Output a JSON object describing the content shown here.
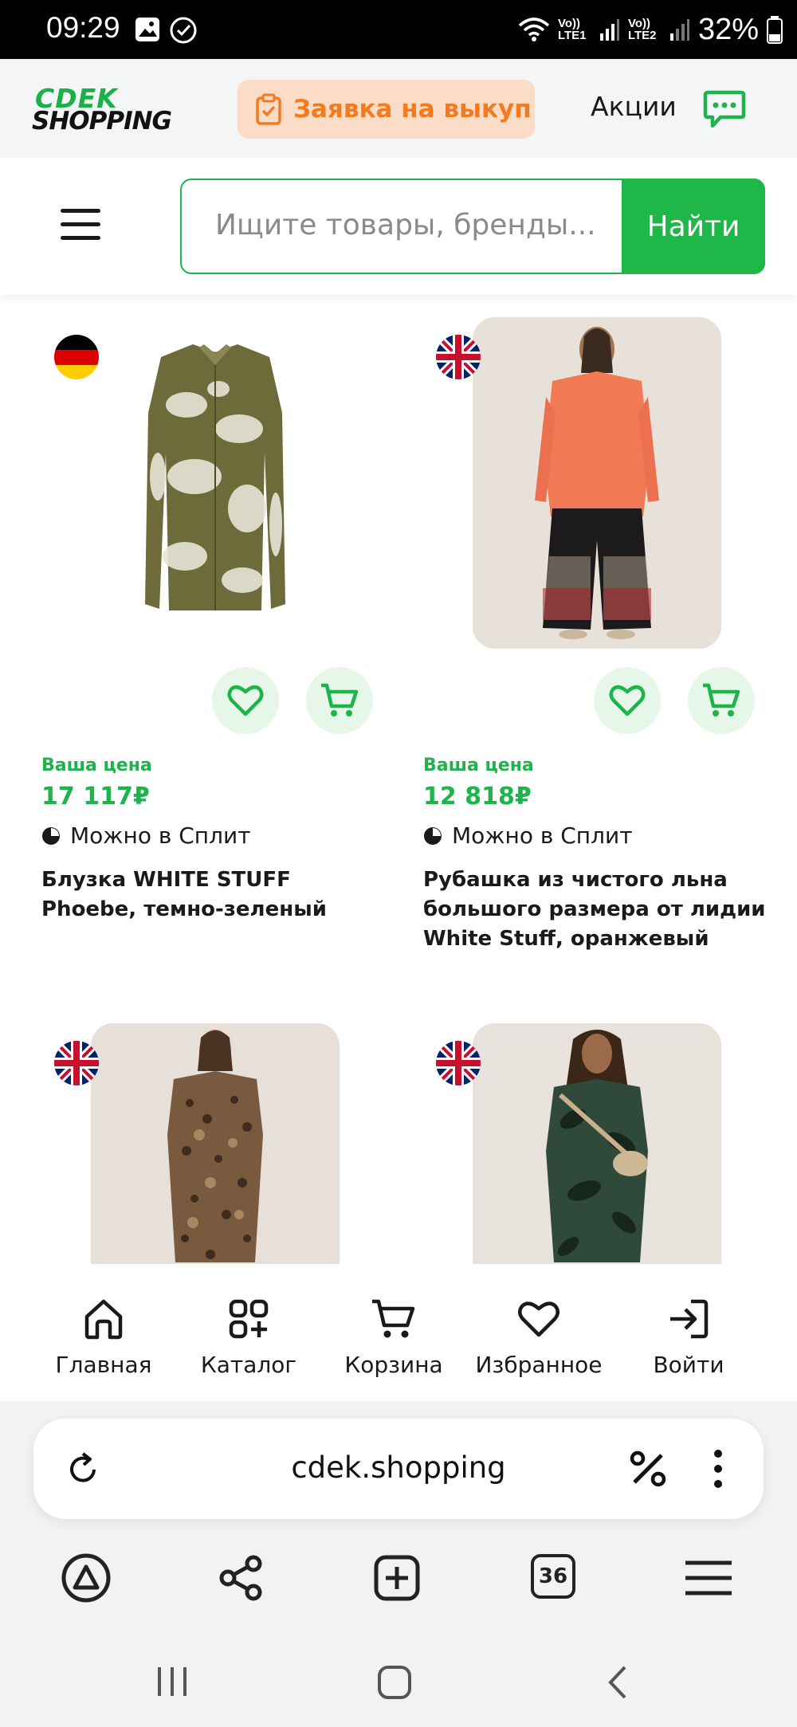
{
  "status_bar": {
    "time": "09:29",
    "sim1": "Vo)) LTE1",
    "sim2": "Vo)) LTE2",
    "battery": "32%"
  },
  "header": {
    "logo_top": "CDEK",
    "logo_bottom": "SHOPPING",
    "buyout_label": "Заявка на выкуп",
    "promo_label": "Акции",
    "accent": "#1db44c",
    "buyout_accent": "#f47a1f"
  },
  "search": {
    "placeholder": "Ищите товары, бренды...",
    "button_label": "Найти"
  },
  "products": [
    {
      "flag": "germany",
      "price_caption": "Ваша цена",
      "price": "17 117₽",
      "split": "Можно в Сплит",
      "title": "Блузка WHITE STUFF Phoebe, темно-зеленый"
    },
    {
      "flag": "uk",
      "price_caption": "Ваша цена",
      "price": "12 818₽",
      "split": "Можно в Сплит",
      "title": "Рубашка из чистого льна большого размера от лидии White Stuff, оранжевый"
    },
    {
      "flag": "uk"
    },
    {
      "flag": "uk"
    }
  ],
  "bottom_nav": [
    {
      "label": "Главная",
      "icon": "home-icon"
    },
    {
      "label": "Каталог",
      "icon": "catalog-icon"
    },
    {
      "label": "Корзина",
      "icon": "cart-icon"
    },
    {
      "label": "Избранное",
      "icon": "heart-icon"
    },
    {
      "label": "Войти",
      "icon": "login-icon"
    }
  ],
  "browser": {
    "url": "cdek.shopping",
    "tabs_count": "36"
  }
}
